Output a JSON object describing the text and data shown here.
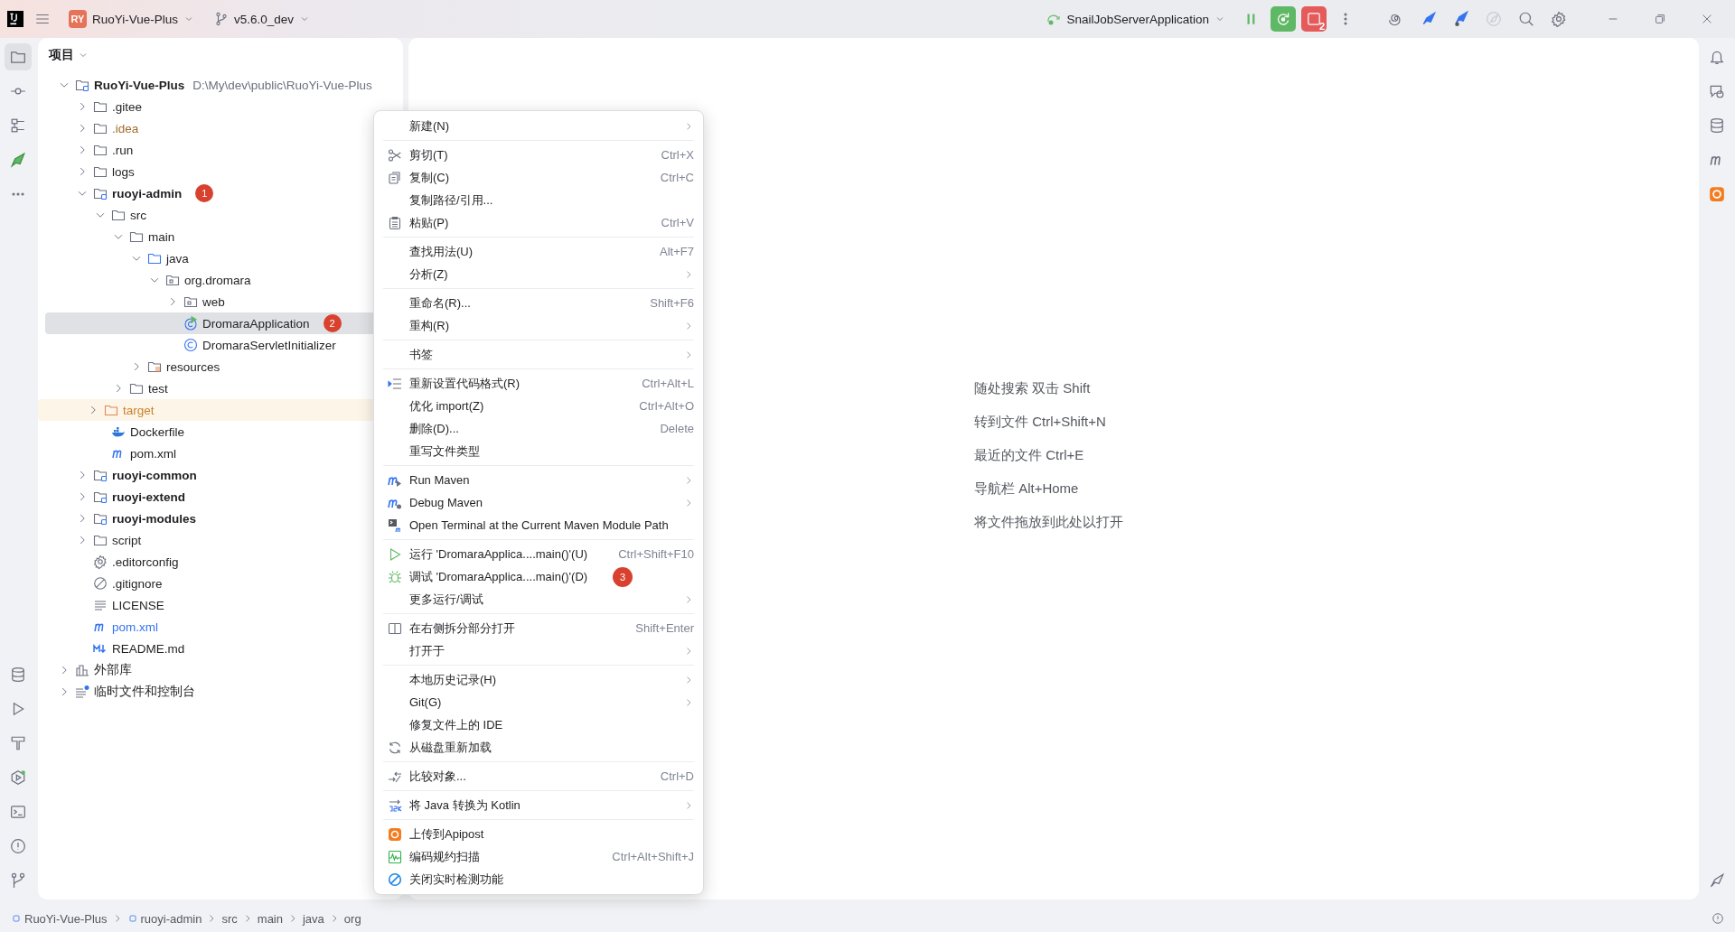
{
  "title_bar": {
    "project_badge": "RY",
    "project": "RuoYi-Vue-Plus",
    "branch": "v5.6.0_dev",
    "run_config": "SnailJobServerApplication",
    "stop_count": "2"
  },
  "project_panel": {
    "title": "项目",
    "tree": [
      {
        "name": "RuoYi-Vue-Plus",
        "kind": "module",
        "path": "D:\\My\\dev\\public\\RuoYi-Vue-Plus",
        "expanded": true,
        "selected": false,
        "children": [
          {
            "name": ".gitee",
            "kind": "folder",
            "expanded": false,
            "selected": false
          },
          {
            "name": ".idea",
            "kind": "ignored-folder",
            "expanded": false,
            "selected": false
          },
          {
            "name": ".run",
            "kind": "folder",
            "expanded": false,
            "selected": false
          },
          {
            "name": "logs",
            "kind": "folder",
            "expanded": false,
            "selected": false
          },
          {
            "name": "ruoyi-admin",
            "kind": "module",
            "expanded": true,
            "selected": false,
            "badge": "1",
            "children": [
              {
                "name": "src",
                "kind": "folder",
                "expanded": true,
                "selected": false,
                "children": [
                  {
                    "name": "main",
                    "kind": "folder",
                    "expanded": true,
                    "selected": false,
                    "children": [
                      {
                        "name": "java",
                        "kind": "source-folder",
                        "expanded": true,
                        "selected": false,
                        "children": [
                          {
                            "name": "org.dromara",
                            "kind": "package",
                            "expanded": true,
                            "selected": false,
                            "children": [
                              {
                                "name": "web",
                                "kind": "package",
                                "expanded": false,
                                "selected": false
                              },
                              {
                                "name": "DromaraApplication",
                                "kind": "run-class",
                                "selected": true,
                                "badge": "2"
                              },
                              {
                                "name": "DromaraServletInitializer",
                                "kind": "class",
                                "selected": false
                              }
                            ]
                          }
                        ]
                      },
                      {
                        "name": "resources",
                        "kind": "resources",
                        "expanded": false,
                        "selected": false
                      }
                    ]
                  },
                  {
                    "name": "test",
                    "kind": "folder",
                    "expanded": false,
                    "selected": false
                  }
                ]
              },
              {
                "name": "target",
                "kind": "excluded-folder",
                "expanded": false,
                "selected": false
              },
              {
                "name": "Dockerfile",
                "kind": "docker",
                "selected": false
              },
              {
                "name": "pom.xml",
                "kind": "maven",
                "selected": false
              }
            ]
          },
          {
            "name": "ruoyi-common",
            "kind": "module",
            "expanded": false,
            "selected": false
          },
          {
            "name": "ruoyi-extend",
            "kind": "module",
            "expanded": false,
            "selected": false
          },
          {
            "name": "ruoyi-modules",
            "kind": "module",
            "expanded": false,
            "selected": false
          },
          {
            "name": "script",
            "kind": "folder",
            "expanded": false,
            "selected": false
          },
          {
            "name": ".editorconfig",
            "kind": "config",
            "selected": false
          },
          {
            "name": ".gitignore",
            "kind": "ignore-file",
            "selected": false
          },
          {
            "name": "LICENSE",
            "kind": "text",
            "selected": false
          },
          {
            "name": "pom.xml",
            "kind": "modified-maven",
            "selected": false
          },
          {
            "name": "README.md",
            "kind": "markdown",
            "selected": false
          }
        ]
      },
      {
        "name": "外部库",
        "kind": "library",
        "expanded": false,
        "selected": false
      },
      {
        "name": "临时文件和控制台",
        "kind": "scratch",
        "expanded": false,
        "selected": false
      }
    ]
  },
  "context_menu": {
    "groups": [
      {
        "items": [
          {
            "label": "新建(N)",
            "kind": "plain",
            "submenu": true
          }
        ]
      },
      {
        "items": [
          {
            "label": "剪切(T)",
            "kind": "cut",
            "shortcut": "Ctrl+X",
            "submenu": false
          },
          {
            "label": "复制(C)",
            "kind": "copy",
            "shortcut": "Ctrl+C",
            "submenu": false
          },
          {
            "label": "复制路径/引用...",
            "kind": "plain",
            "submenu": false
          },
          {
            "label": "粘贴(P)",
            "kind": "paste",
            "shortcut": "Ctrl+V",
            "submenu": false
          }
        ]
      },
      {
        "items": [
          {
            "label": "查找用法(U)",
            "kind": "plain",
            "shortcut": "Alt+F7",
            "submenu": false
          },
          {
            "label": "分析(Z)",
            "kind": "plain",
            "submenu": true
          }
        ]
      },
      {
        "items": [
          {
            "label": "重命名(R)...",
            "kind": "plain",
            "shortcut": "Shift+F6",
            "submenu": false
          },
          {
            "label": "重构(R)",
            "kind": "plain",
            "submenu": true
          }
        ]
      },
      {
        "items": [
          {
            "label": "书签",
            "kind": "plain",
            "submenu": true
          }
        ]
      },
      {
        "items": [
          {
            "label": "重新设置代码格式(R)",
            "kind": "reformat",
            "shortcut": "Ctrl+Alt+L",
            "submenu": false
          },
          {
            "label": "优化 import(Z)",
            "kind": "plain",
            "shortcut": "Ctrl+Alt+O",
            "submenu": false
          },
          {
            "label": "删除(D)...",
            "kind": "plain",
            "shortcut": "Delete",
            "submenu": false
          },
          {
            "label": "重写文件类型",
            "kind": "plain",
            "submenu": false
          }
        ]
      },
      {
        "items": [
          {
            "label": "Run Maven",
            "kind": "run-maven",
            "submenu": true
          },
          {
            "label": "Debug Maven",
            "kind": "debug-maven",
            "submenu": true
          },
          {
            "label": "Open Terminal at the Current Maven Module Path",
            "kind": "terminal",
            "submenu": false
          }
        ]
      },
      {
        "items": [
          {
            "label": "运行 'DromaraApplica....main()'(U)",
            "kind": "run",
            "shortcut": "Ctrl+Shift+F10",
            "submenu": false
          },
          {
            "label": "调试 'DromaraApplica....main()'(D)",
            "kind": "debug",
            "badge": "3",
            "submenu": false
          },
          {
            "label": "更多运行/调试",
            "kind": "plain",
            "submenu": true
          }
        ]
      },
      {
        "items": [
          {
            "label": "在右侧拆分部分打开",
            "kind": "split",
            "shortcut": "Shift+Enter",
            "submenu": false
          },
          {
            "label": "打开于",
            "kind": "plain",
            "submenu": true
          }
        ]
      },
      {
        "items": [
          {
            "label": "本地历史记录(H)",
            "kind": "plain",
            "submenu": true
          },
          {
            "label": "Git(G)",
            "kind": "plain",
            "submenu": true
          },
          {
            "label": "修复文件上的 IDE",
            "kind": "plain",
            "submenu": false
          },
          {
            "label": "从磁盘重新加载",
            "kind": "reload",
            "submenu": false
          }
        ]
      },
      {
        "items": [
          {
            "label": "比较对象...",
            "kind": "compare",
            "shortcut": "Ctrl+D",
            "submenu": false
          }
        ]
      },
      {
        "items": [
          {
            "label": "将 Java 转换为 Kotlin",
            "kind": "j2k",
            "submenu": true
          }
        ]
      },
      {
        "items": [
          {
            "label": "上传到Apipost",
            "kind": "apipost",
            "submenu": false
          },
          {
            "label": "编码规约扫描",
            "kind": "scan",
            "shortcut": "Ctrl+Alt+Shift+J",
            "submenu": false
          },
          {
            "label": "关闭实时检测功能",
            "kind": "disable",
            "submenu": false
          }
        ]
      }
    ]
  },
  "editor": {
    "hints": [
      "随处搜索 双击 Shift",
      "转到文件 Ctrl+Shift+N",
      "最近的文件 Ctrl+E",
      "导航栏 Alt+Home",
      "将文件拖放到此处以打开"
    ]
  },
  "status_bar": {
    "breadcrumbs": [
      {
        "label": "RuoYi-Vue-Plus",
        "kind": "module"
      },
      {
        "label": "ruoyi-admin",
        "kind": "module"
      },
      {
        "label": "src",
        "kind": "folder"
      },
      {
        "label": "main",
        "kind": "folder"
      },
      {
        "label": "java",
        "kind": "folder"
      },
      {
        "label": "org",
        "kind": "folder"
      }
    ]
  }
}
